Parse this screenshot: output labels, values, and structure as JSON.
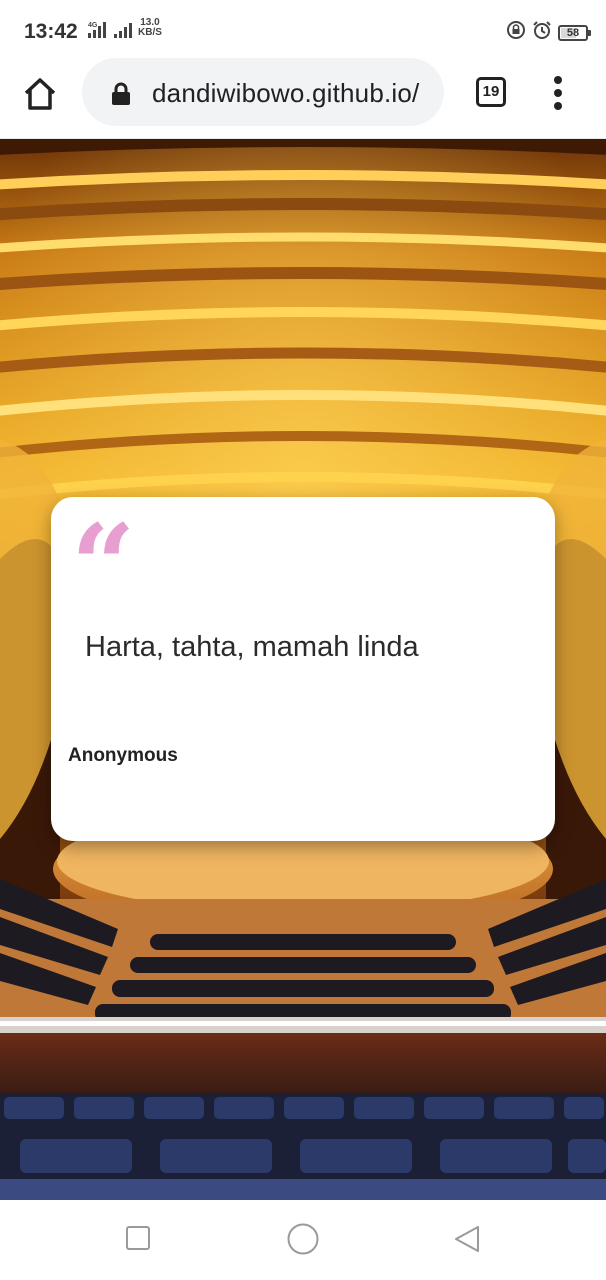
{
  "status_bar": {
    "time": "13:42",
    "network_label": "4G",
    "speed_value": "13.0",
    "speed_unit": "KB/S",
    "battery": "58",
    "icons": [
      "signal-icon",
      "lock-rotation-icon",
      "alarm-icon",
      "battery-icon"
    ]
  },
  "browser": {
    "url": "dandiwibowo.github.io/",
    "tab_count": "19",
    "icons": [
      "home-icon",
      "lock-icon",
      "tabs-icon",
      "more-vert-icon"
    ]
  },
  "quote": {
    "mark": "“",
    "text": "Harta, tahta, mamah linda",
    "author": "Anonymous",
    "accent_color": "#e69fd0"
  },
  "background": {
    "description_color_top": "#d8901c",
    "description_color_seats": "#2a2a3a"
  },
  "nav_bar": {
    "icons": [
      "recents-square-icon",
      "home-circle-icon",
      "back-triangle-icon"
    ]
  }
}
